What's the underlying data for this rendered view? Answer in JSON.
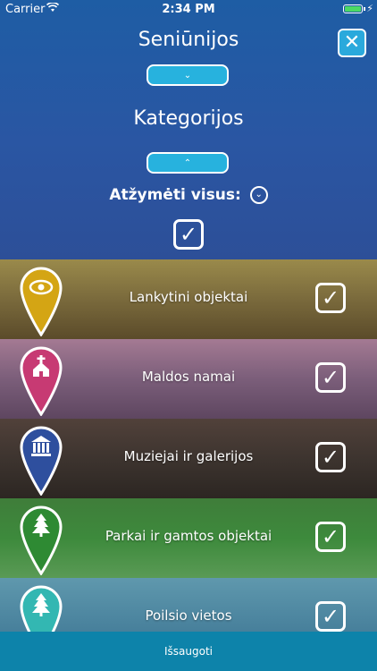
{
  "status_bar": {
    "carrier": "Carrier",
    "time": "2:34 PM",
    "battery_level": 1.0
  },
  "header": {
    "seniunijos_title": "Seniūnijos",
    "seniunijos_toggle": "⌄",
    "kategorijos_title": "Kategorijos",
    "kategorijos_toggle": "⌃",
    "close_icon": "close-icon",
    "select_all_label": "Atžymėti visus:",
    "select_all_chevron": "⌄",
    "select_all_checked": "✓"
  },
  "categories": [
    {
      "label": "Lankytini objektai",
      "icon": "eye-icon",
      "pin_color": "#d4a514",
      "checked": "✓"
    },
    {
      "label": "Maldos namai",
      "icon": "church-icon",
      "pin_color": "#c73a73",
      "checked": "✓"
    },
    {
      "label": "Muziejai ir galerijos",
      "icon": "museum-icon",
      "pin_color": "#2e4f9e",
      "checked": "✓"
    },
    {
      "label": "Parkai ir gamtos objektai",
      "icon": "tree-icon",
      "pin_color": "#2e8a33",
      "checked": "✓"
    },
    {
      "label": "Poilsio vietos",
      "icon": "tree-icon",
      "pin_color": "#33b7b2",
      "checked": "✓"
    }
  ],
  "footer": {
    "save_label": "Išsaugoti"
  }
}
